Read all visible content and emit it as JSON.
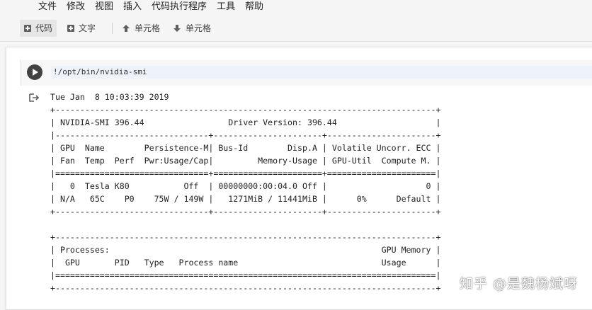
{
  "menu": [
    "文件",
    "修改",
    "视图",
    "插入",
    "代码执行程序",
    "工具",
    "帮助"
  ],
  "toolbar": {
    "add_code": "代码",
    "add_text": "文字",
    "cell_up": "单元格",
    "cell_down": "单元格"
  },
  "cell": {
    "code": "!/opt/bin/nvidia-smi"
  },
  "output": {
    "lines": [
      "Tue Jan  8 10:03:39 2019",
      "+-----------------------------------------------------------------------------+",
      "| NVIDIA-SMI 396.44                 Driver Version: 396.44                    |",
      "|-------------------------------+----------------------+----------------------+",
      "| GPU  Name        Persistence-M| Bus-Id        Disp.A | Volatile Uncorr. ECC |",
      "| Fan  Temp  Perf  Pwr:Usage/Cap|         Memory-Usage | GPU-Util  Compute M. |",
      "|===============================+======================+======================|",
      "|   0  Tesla K80           Off  | 00000000:00:04.0 Off |                    0 |",
      "| N/A   65C    P0    75W / 149W |   1271MiB / 11441MiB |      0%      Default |",
      "+-------------------------------+----------------------+----------------------+",
      "",
      "+-----------------------------------------------------------------------------+",
      "| Processes:                                                       GPU Memory |",
      "|  GPU       PID   Type   Process name                             Usage      |",
      "|=============================================================================|",
      "+-----------------------------------------------------------------------------+"
    ]
  },
  "watermark": "知乎 @是魏杨斌呀",
  "colors": {
    "run_button": "#424242",
    "code_bg": "#eef3fb"
  }
}
